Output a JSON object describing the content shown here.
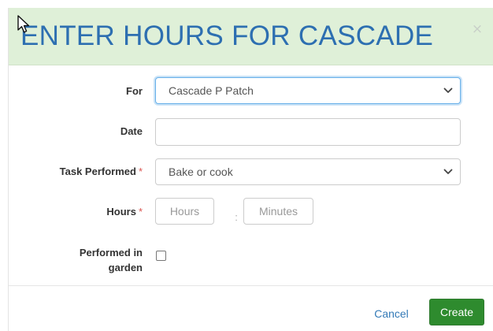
{
  "modal": {
    "title": "ENTER HOURS FOR CASCADE",
    "close_label": "×"
  },
  "form": {
    "for": {
      "label": "For",
      "selected": "Cascade P Patch"
    },
    "date": {
      "label": "Date",
      "value": ""
    },
    "task": {
      "label": "Task Performed",
      "required_mark": "*",
      "selected": "Bake or cook"
    },
    "hours": {
      "label": "Hours",
      "required_mark": "*",
      "hours_placeholder": "Hours",
      "separator": ":",
      "minutes_placeholder": "Minutes"
    },
    "in_garden": {
      "label_line1": "Performed in",
      "label_line2": "garden",
      "checked": false
    }
  },
  "footer": {
    "cancel_label": "Cancel",
    "create_label": "Create"
  },
  "colors": {
    "header_background": "#dff0d8",
    "title_color": "#2d6fb1",
    "create_button": "#2e8b2e",
    "required_mark": "#d9534f",
    "link_color": "#337ab7"
  },
  "icons": [
    "cursor-icon",
    "close-icon",
    "chevron-down-icon"
  ]
}
